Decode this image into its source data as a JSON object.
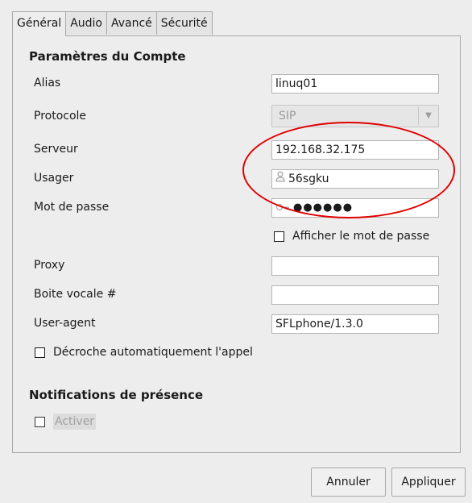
{
  "tabs": [
    {
      "label": "Général",
      "active": true
    },
    {
      "label": "Audio",
      "active": false
    },
    {
      "label": "Avancé",
      "active": false
    },
    {
      "label": "Sécurité",
      "active": false
    }
  ],
  "account_section": {
    "title": "Paramètres du Compte",
    "alias": {
      "label": "Alias",
      "value": "linuq01"
    },
    "protocol": {
      "label": "Protocole",
      "value": "SIP"
    },
    "server": {
      "label": "Serveur",
      "value": "192.168.32.175"
    },
    "user": {
      "label": "Usager",
      "value": "56sgku",
      "icon": "user-icon"
    },
    "password": {
      "label": "Mot de passe",
      "value": "●●●●●●",
      "icon": "key-icon"
    },
    "show_password": {
      "label": "Afficher le mot de passe",
      "checked": false
    },
    "proxy": {
      "label": "Proxy",
      "value": ""
    },
    "voicemail": {
      "label": "Boite vocale #",
      "value": ""
    },
    "user_agent": {
      "label": "User-agent",
      "value": "SFLphone/1.3.0"
    },
    "auto_answer": {
      "label": "Décroche automatiquement l'appel",
      "checked": false
    }
  },
  "presence_section": {
    "title": "Notifications de présence",
    "enable": {
      "label": "Activer",
      "checked": false,
      "disabled": true
    }
  },
  "buttons": {
    "cancel": "Annuler",
    "apply": "Appliquer"
  },
  "colors": {
    "annotation": "#e00000",
    "background": "#ededed"
  }
}
